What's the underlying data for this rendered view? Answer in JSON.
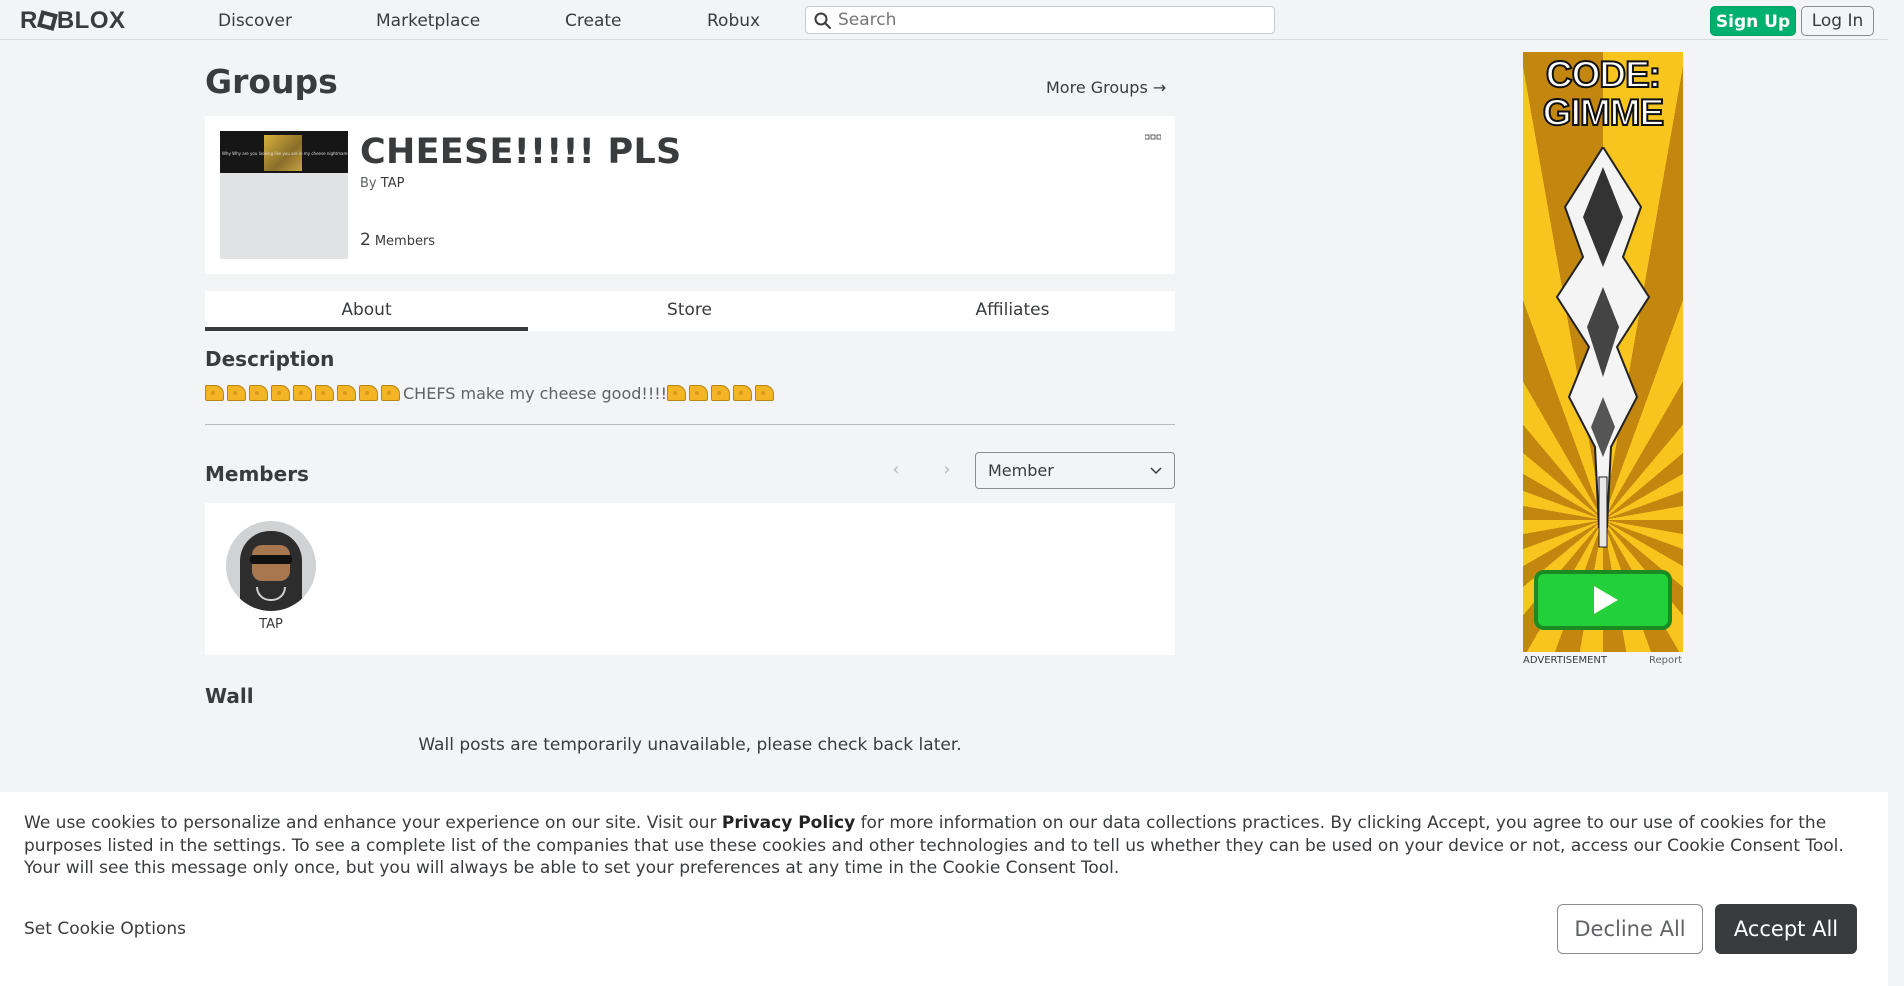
{
  "nav": {
    "logo_pre": "R",
    "logo_post": "BLOX",
    "links": [
      "Discover",
      "Marketplace",
      "Create",
      "Robux"
    ],
    "search_placeholder": "Search",
    "signup": "Sign Up",
    "login": "Log In"
  },
  "page": {
    "title": "Groups",
    "more_groups": "More Groups →"
  },
  "group": {
    "name": "CHEESE!!!!! PLS",
    "by_prefix": "By",
    "owner": "TAP",
    "member_count": "2",
    "member_label": "Members",
    "emblem_text": "Why Why are you looking like you are in my cheese nightmare"
  },
  "tabs": [
    "About",
    "Store",
    "Affiliates"
  ],
  "description": {
    "heading": "Description",
    "cheese_before": 9,
    "text": "CHEFS make my cheese good!!!!",
    "cheese_after": 5
  },
  "members": {
    "heading": "Members",
    "role_selected": "Member",
    "list": [
      {
        "name": "TAP"
      }
    ]
  },
  "wall": {
    "heading": "Wall",
    "message": "Wall posts are temporarily unavailable, please check back later."
  },
  "ad": {
    "headline_1": "CODE:",
    "headline_2": "GIMME",
    "label": "ADVERTISEMENT",
    "report": "Report"
  },
  "cookie": {
    "text_1": "We use cookies to personalize and enhance your experience on our site. Visit our ",
    "privacy_link": "Privacy Policy",
    "text_2": " for more information on our data collections practices. By clicking Accept, you agree to our use of cookies for the purposes listed in the settings. To see a complete list of the companies that use these cookies and other technologies and to tell us whether they can be used on your device or not, access our Cookie Consent Tool. Your will see this message only once, but you will always be able to set your preferences at any time in the Cookie Consent Tool.",
    "options": "Set Cookie Options",
    "decline": "Decline All",
    "accept": "Accept All"
  },
  "colors": {
    "signup_green": "#00b06f",
    "accept_dark": "#393b3d",
    "cheese_yellow": "#f3b526"
  }
}
